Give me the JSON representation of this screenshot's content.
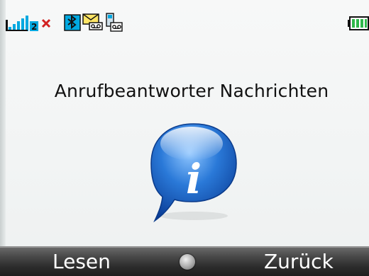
{
  "status_bar": {
    "icons": [
      "signal-strength-icon",
      "no-service-icon",
      "bluetooth-icon",
      "voicemail-message-icon",
      "dual-phone-icon",
      "battery-icon"
    ],
    "colors": {
      "accent": "#00a8e0",
      "alert": "#d22222",
      "battery": "#2fb84a"
    }
  },
  "main": {
    "title": "Anrufbeantworter Nachrichten",
    "icon": "info-bubble-icon",
    "icon_letter": "i"
  },
  "softkeys": {
    "left_label": "Lesen",
    "right_label": "Zurück",
    "center": "select-key-icon"
  }
}
